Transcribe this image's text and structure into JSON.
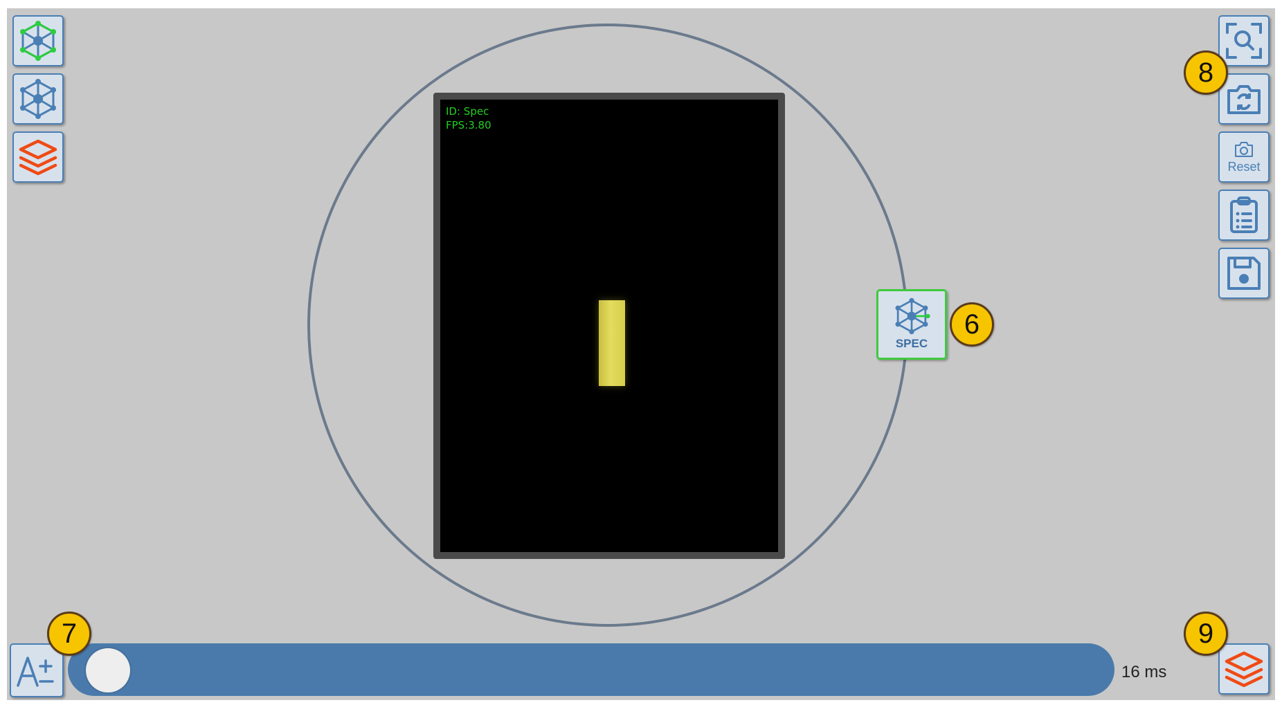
{
  "viewer": {
    "id_text": "ID: Spec",
    "fps_text": "FPS:3.80"
  },
  "spec_button": {
    "label": "SPEC"
  },
  "right_toolbar": {
    "reset_label": "Reset"
  },
  "exposure": {
    "value_text": "16 ms",
    "slider_fraction": 0.0
  },
  "callouts": [
    "6",
    "7",
    "8",
    "9"
  ],
  "colors": {
    "accent_blue": "#4a7fb5",
    "active_green": "#3ecb3e",
    "layers_orange": "#f04a14",
    "badge_yellow": "#f7c400"
  },
  "icons": {
    "left": [
      "network-active-icon",
      "network-icon",
      "layers-icon"
    ],
    "right": [
      "zoom-fit-icon",
      "camera-switch-icon",
      "camera-reset-icon",
      "clipboard-list-icon",
      "save-icon"
    ],
    "bottom_left": "font-size-icon",
    "bottom_right": "layers-icon"
  }
}
